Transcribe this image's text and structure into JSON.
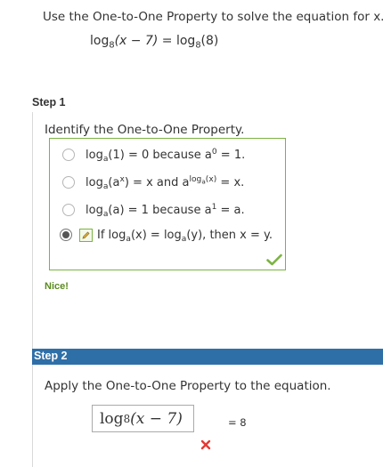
{
  "problem": {
    "prompt": "Use the One-to-One Property to solve the equation for x.",
    "equation": {
      "left_fn": "log",
      "left_base": "8",
      "left_arg": "(x − 7)",
      "equals": " = ",
      "right_fn": "log",
      "right_base": "8",
      "right_arg": "(8)"
    }
  },
  "step1": {
    "title": "Step 1",
    "instruction": "Identify the One-to-One Property.",
    "options": [
      {
        "parts": [
          "log",
          "a",
          "(1) = 0 because a",
          "0",
          " = 1."
        ],
        "selected": false
      },
      {
        "parts": [
          "log",
          "a",
          "(a",
          "x",
          ") = x and a",
          "log",
          "a",
          "(x)",
          " = x."
        ],
        "selected": false
      },
      {
        "parts": [
          "log",
          "a",
          "(a) = 1 because a",
          "1",
          " = a."
        ],
        "selected": false
      },
      {
        "parts": [
          "If log",
          "a",
          "(x) = log",
          "a",
          "(y), then x = y."
        ],
        "selected": true
      }
    ],
    "feedback": "Nice!",
    "status_icon": "check-icon",
    "accent_color": "#7cb342"
  },
  "step2": {
    "title": "Step 2",
    "instruction": "Apply the One-to-One Property to the equation.",
    "answer": {
      "fn": "log",
      "base": "8",
      "arg": "(x − 7)"
    },
    "right_side": "= 8",
    "status_icon": "x-icon",
    "header_color": "#2f6fa8",
    "error_color": "#e53935"
  }
}
